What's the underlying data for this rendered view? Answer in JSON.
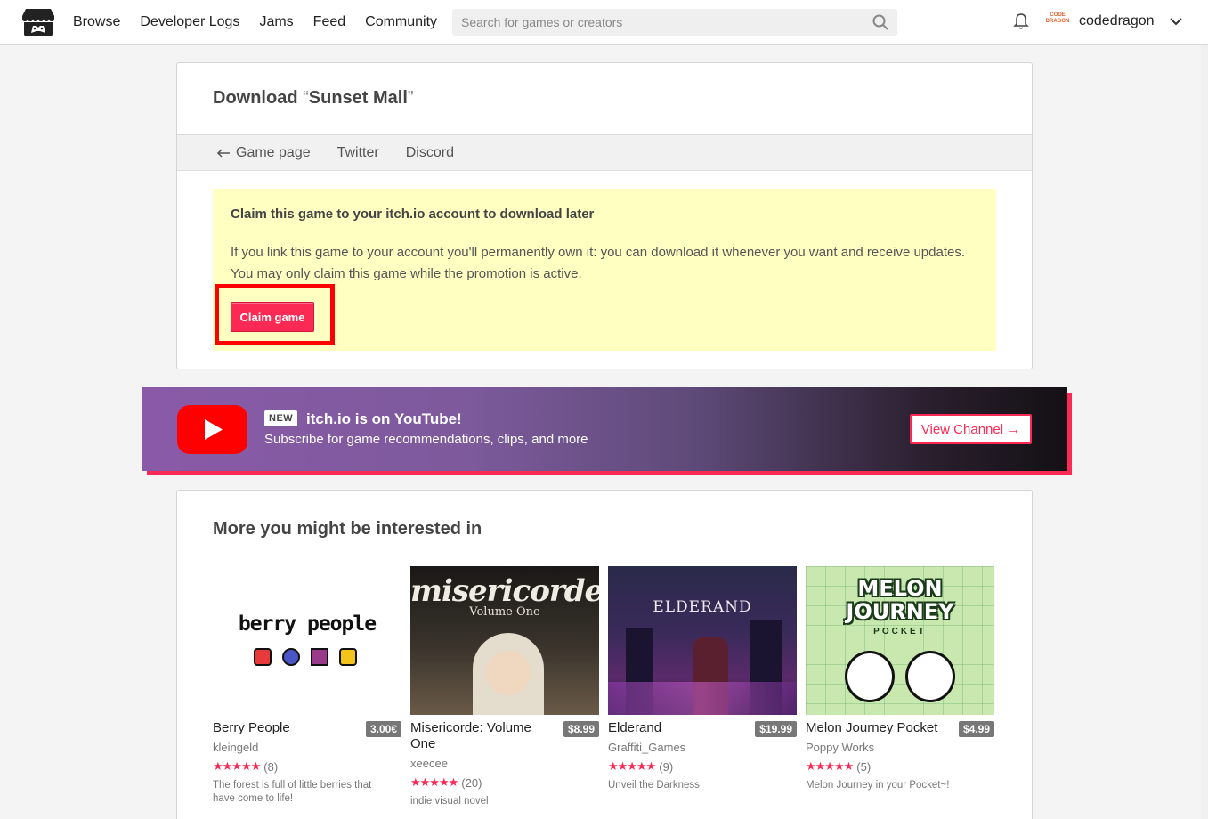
{
  "header": {
    "nav": [
      "Browse",
      "Developer Logs",
      "Jams",
      "Feed",
      "Community"
    ],
    "search_placeholder": "Search for games or creators",
    "avatar_text": "CODE DRAGON",
    "username": "codedragon"
  },
  "download": {
    "title_prefix": "Download ",
    "open_quote": "“",
    "game_name": "Sunset Mall",
    "close_quote": "”",
    "links": [
      "Game page",
      "Twitter",
      "Discord"
    ],
    "notice_title": "Claim this game to your itch.io account to download later",
    "notice_body": "If you link this game to your account you'll permanently own it: you can download it whenever you want and receive updates. You may only claim this game while the promotion is active.",
    "claim_label": "Claim game"
  },
  "youtube": {
    "badge": "NEW",
    "title": "itch.io is on YouTube!",
    "subtitle": "Subscribe for game recommendations, clips, and more",
    "button": "View Channel →"
  },
  "recs": {
    "heading": "More you might be interested in",
    "games": [
      {
        "title": "Berry People",
        "price": "3.00€",
        "author": "kleingeld",
        "rating_count": "(8)",
        "desc": "The forest is full of little berries that have come to life!",
        "thumb_text": "berry people"
      },
      {
        "title": "Misericorde: Volume One",
        "price": "$8.99",
        "author": "xeecee",
        "rating_count": "(20)",
        "desc": "indie visual novel",
        "thumb_text": "misericorde",
        "thumb_sub": "Volume One"
      },
      {
        "title": "Elderand",
        "price": "$19.99",
        "author": "Graffiti_Games",
        "rating_count": "(9)",
        "desc": "Unveil the Darkness",
        "thumb_text": "ELDERAND"
      },
      {
        "title": "Melon Journey Pocket",
        "price": "$4.99",
        "author": "Poppy Works",
        "rating_count": "(5)",
        "desc": "Melon Journey in your Pocket~!",
        "thumb_text": "MELON JOURNEY",
        "thumb_sub": "POCKET"
      }
    ]
  },
  "colors": {
    "accent": "#fa2a55",
    "notice_bg": "#ffffc2",
    "highlight": "#ff0000"
  }
}
